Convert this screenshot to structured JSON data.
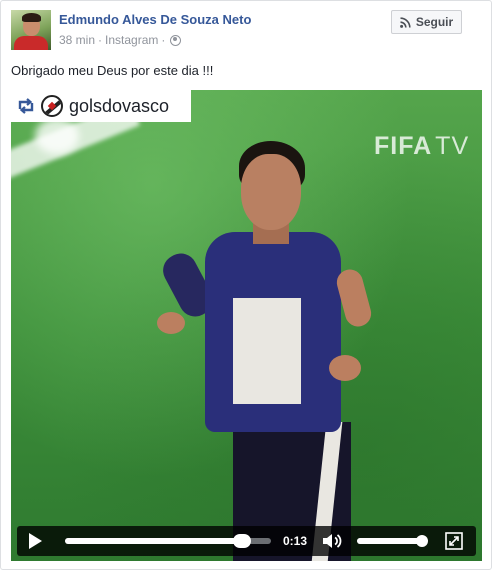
{
  "post": {
    "author": "Edmundo Alves De Souza Neto",
    "time": "38 min",
    "separator": "·",
    "source": "Instagram",
    "text": "Obrigado meu Deus por este dia !!!"
  },
  "follow_button": {
    "label": "Seguir",
    "icon": "rss-icon"
  },
  "video": {
    "badge_user": "golsdovasco",
    "watermark_brand": "FIFA",
    "watermark_suffix": "TV",
    "current_time": "0:13",
    "progress_fraction": 0.86,
    "volume_fraction": 0.93
  },
  "colors": {
    "link_blue": "#365899",
    "meta_gray": "#90949c",
    "controls_bg": "#000000"
  }
}
